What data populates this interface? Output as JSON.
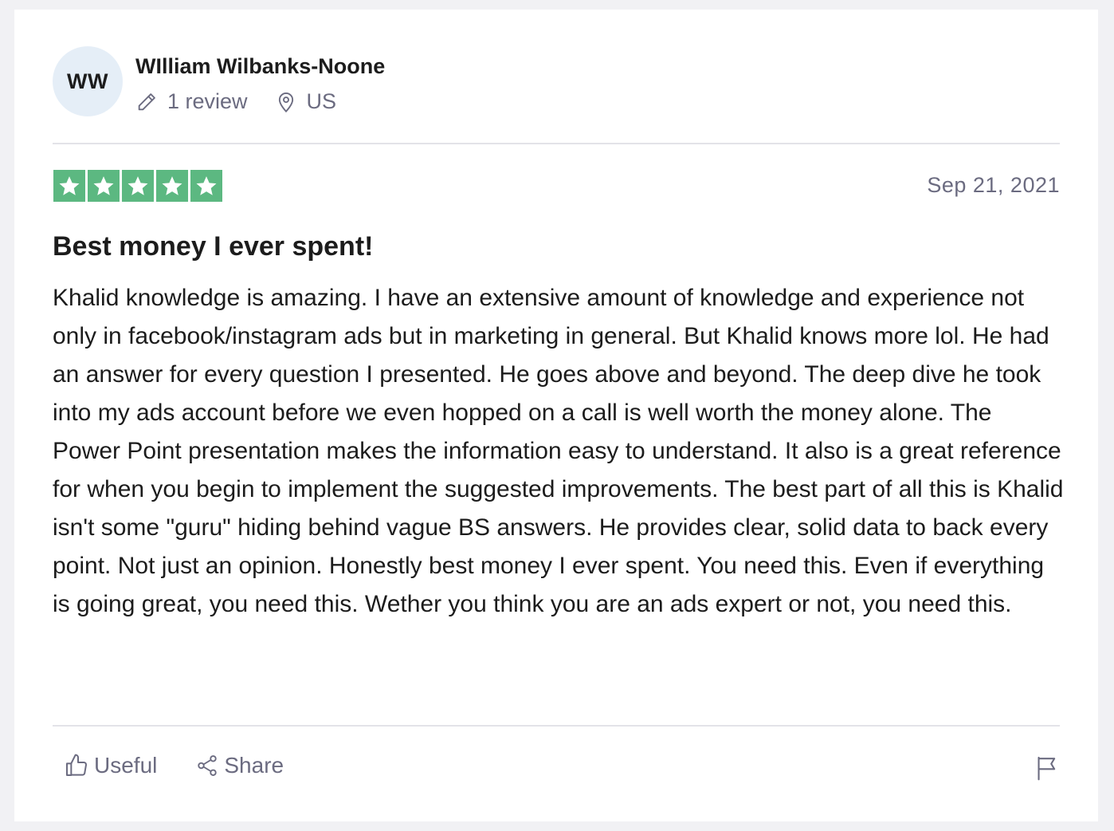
{
  "reviewer": {
    "initials": "WW",
    "name": "WIlliam Wilbanks-Noone",
    "review_count": "1 review",
    "country": "US"
  },
  "review": {
    "rating": 5,
    "date": "Sep 21, 2021",
    "title": "Best money I ever spent!",
    "body": "Khalid knowledge is amazing. I have an extensive amount of knowledge and experience not only in facebook/instagram ads but in marketing in general. But Khalid knows more lol. He had an answer for every question I presented. He goes above and beyond. The deep dive he took into my ads account before we even hopped on a call is well worth the money alone. The Power Point presentation makes the information easy to understand. It also is a great reference for when you begin to implement the suggested improvements. The best part of all this is Khalid isn't some \"guru\" hiding behind vague BS answers. He provides clear, solid data to back every point. Not just an opinion. Honestly best money I ever spent. You need this. Even if everything is going great, you need this. Wether you think you are an ads expert or not, you need this."
  },
  "actions": {
    "useful_label": "Useful",
    "share_label": "Share"
  },
  "colors": {
    "star_green": "#5cb881",
    "avatar_bg": "#e5eef7",
    "muted_text": "#6b6b80"
  },
  "icons": {
    "review_count": "pencil-icon",
    "country": "location-pin-icon",
    "useful": "thumbs-up-icon",
    "share": "share-icon",
    "report": "flag-icon",
    "rating": "star-icon"
  }
}
